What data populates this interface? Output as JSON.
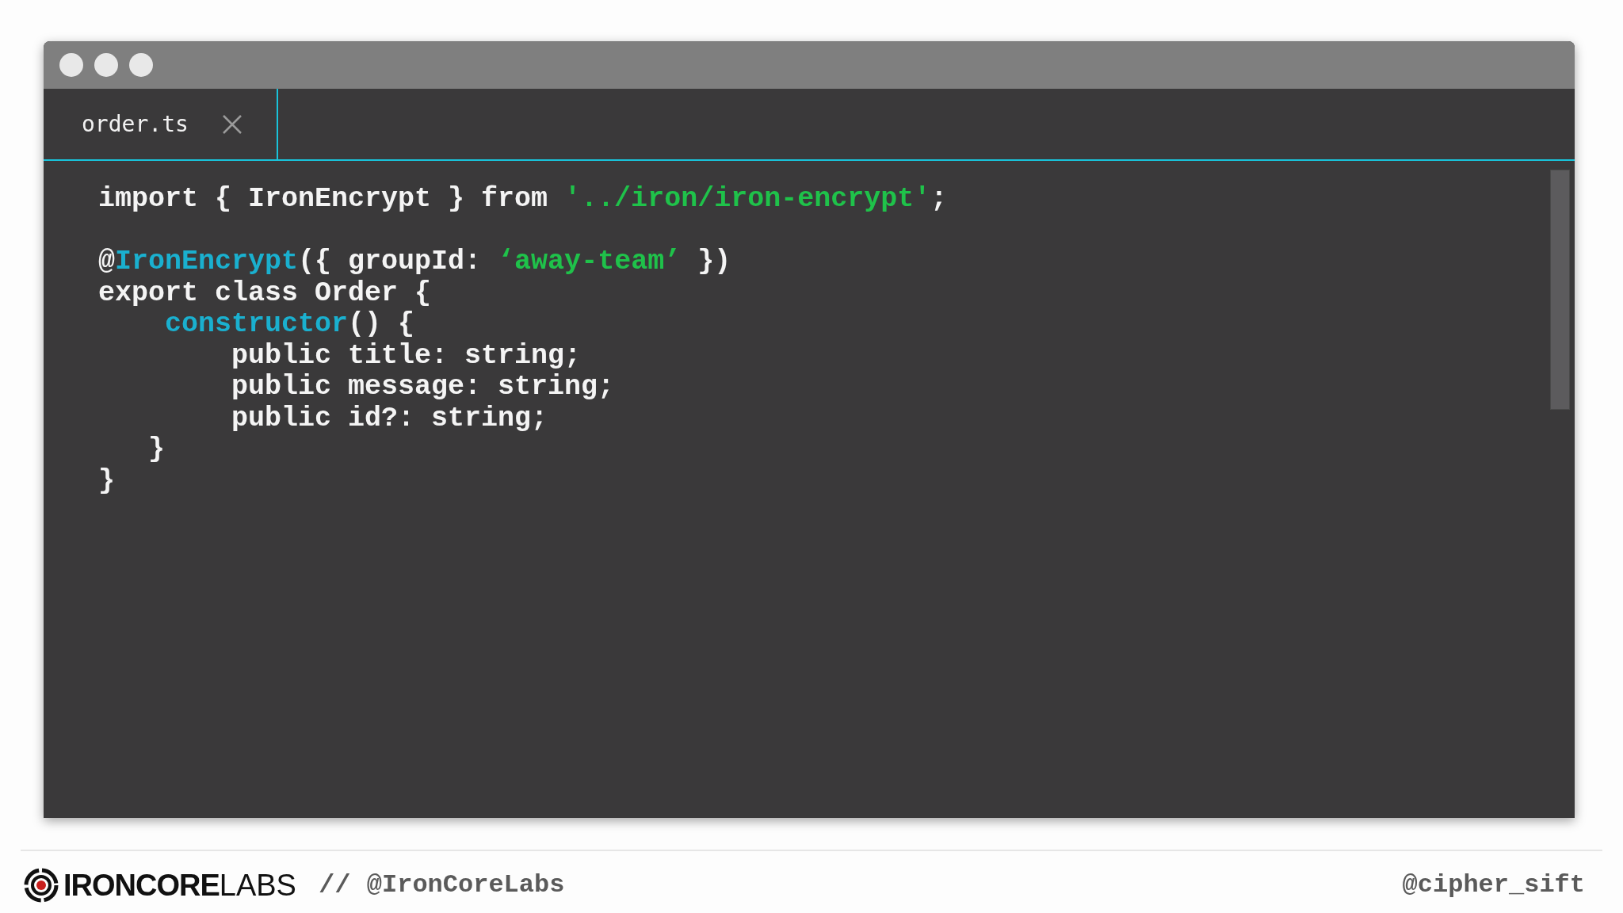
{
  "editor": {
    "tabs": [
      {
        "label": "order.ts",
        "selected": true
      }
    ],
    "lines": [
      {
        "kind": "code",
        "tokens": [
          {
            "text": "import { IronEncrypt } from ",
            "kind": "plain"
          },
          {
            "text": "'../iron/iron-encrypt'",
            "kind": "string"
          },
          {
            "text": ";",
            "kind": "plain"
          }
        ]
      },
      {
        "kind": "blank"
      },
      {
        "kind": "code",
        "tokens": [
          {
            "text": "@",
            "kind": "plain"
          },
          {
            "text": "IronEncrypt",
            "kind": "accent"
          },
          {
            "text": "({ groupId: ",
            "kind": "plain"
          },
          {
            "text": "‘away-team’",
            "kind": "string"
          },
          {
            "text": " })",
            "kind": "plain"
          }
        ]
      },
      {
        "kind": "code",
        "tokens": [
          {
            "text": "export class Order {",
            "kind": "plain"
          }
        ]
      },
      {
        "kind": "indented",
        "tokens": [
          {
            "text": "constructor",
            "kind": "accent"
          },
          {
            "text": "() {",
            "kind": "plain"
          }
        ]
      },
      {
        "kind": "code",
        "tokens": [
          {
            "text": "        public title: string;",
            "kind": "plain"
          }
        ]
      },
      {
        "kind": "code",
        "tokens": [
          {
            "text": "        public message: string;",
            "kind": "plain"
          }
        ]
      },
      {
        "kind": "code",
        "tokens": [
          {
            "text": "        public id?: string;",
            "kind": "plain"
          }
        ]
      },
      {
        "kind": "code",
        "tokens": [
          {
            "text": "   }",
            "kind": "plain"
          }
        ]
      },
      {
        "kind": "code",
        "tokens": [
          {
            "text": "}",
            "kind": "plain"
          }
        ]
      }
    ]
  },
  "footer": {
    "brand_bold": "IRONCORE",
    "brand_light": "LABS",
    "separator": "//",
    "handle": "@IronCoreLabs",
    "author": "@cipher_sift"
  }
}
